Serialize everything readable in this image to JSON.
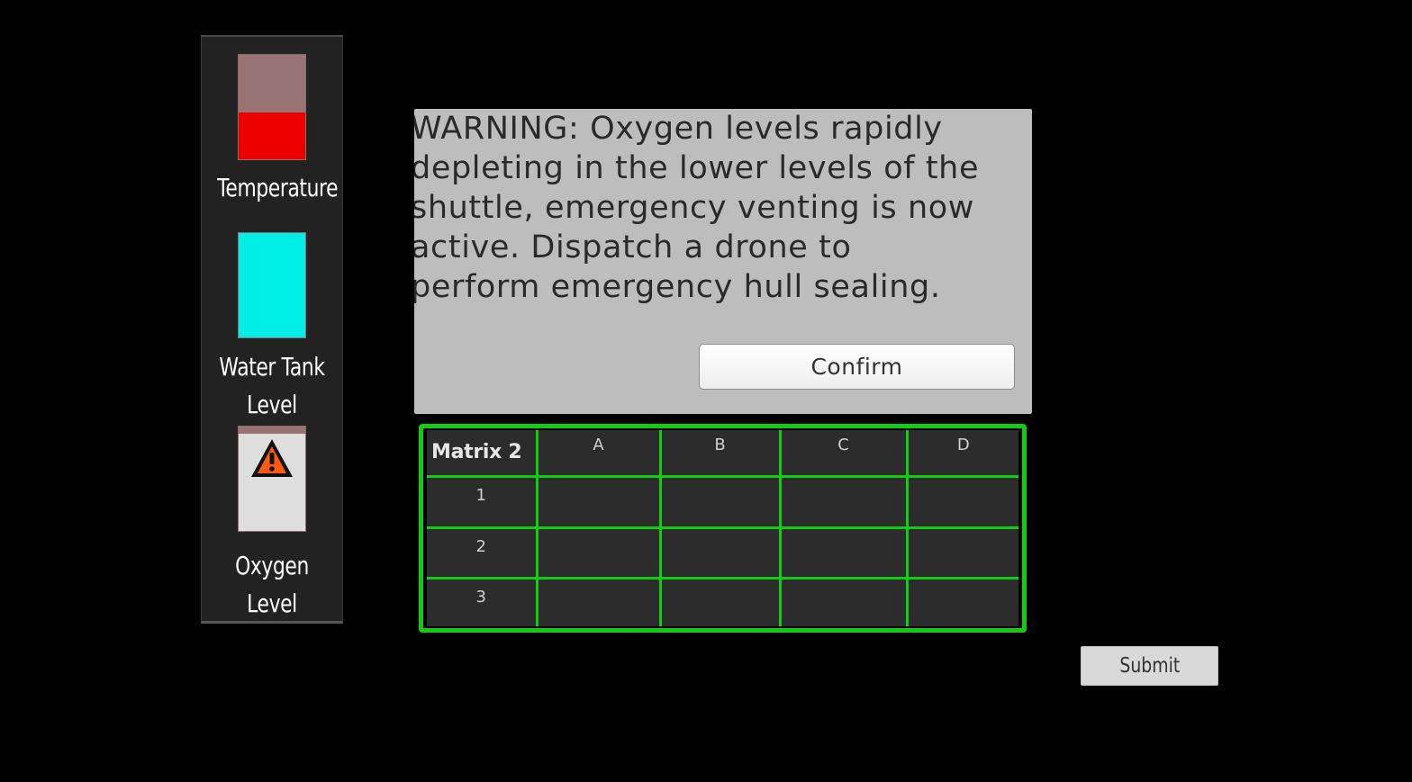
{
  "gauges": {
    "temperature": {
      "label": "Temperature",
      "fill_percent": 45,
      "fill_color": "#ee0000",
      "empty_color": "#977373"
    },
    "water_tank": {
      "label": "Water Tank\nLevel",
      "fill_percent": 100,
      "fill_color": "#00eee6",
      "empty_color": "#977373"
    },
    "oxygen": {
      "label": "Oxygen Level",
      "fill_percent": 93,
      "fill_color": "#dedede",
      "empty_color": "#977373",
      "alert_icon": "warning-triangle-icon"
    }
  },
  "dialog": {
    "message": "WARNING: Oxygen levels rapidly\ndepleting in the lower levels of the\nshuttle, emergency venting is now\nactive. Dispatch a drone to\nperform emergency hull sealing.",
    "confirm_label": "Confirm"
  },
  "matrix": {
    "title": "Matrix 2",
    "columns": [
      "A",
      "B",
      "C",
      "D"
    ],
    "rows": [
      {
        "label": "1",
        "cells": [
          "",
          "",
          "",
          ""
        ]
      },
      {
        "label": "2",
        "cells": [
          "",
          "",
          "",
          ""
        ]
      },
      {
        "label": "3",
        "cells": [
          "",
          "",
          "",
          ""
        ]
      }
    ],
    "border_color": "#11cc11"
  },
  "submit_label": "Submit"
}
